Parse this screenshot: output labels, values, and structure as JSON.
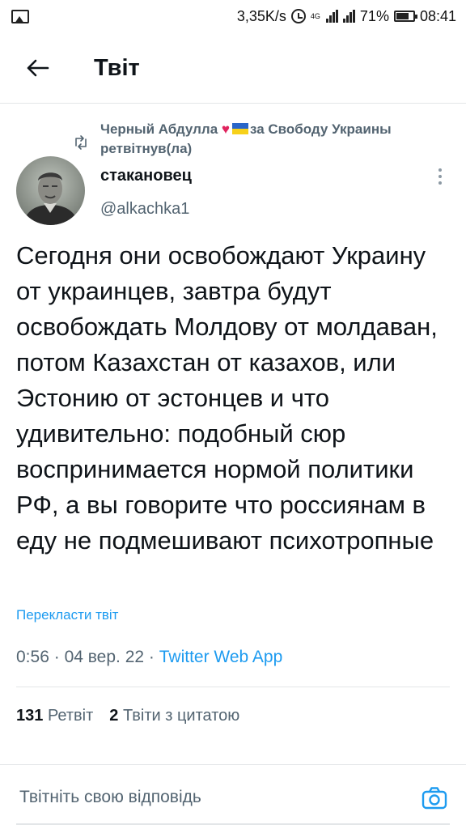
{
  "status_bar": {
    "speed": "3,35K/s",
    "network_tag": "4G",
    "battery": "71%",
    "time": "08:41",
    "icons": [
      "image-icon",
      "alarm-icon",
      "signal-icon",
      "battery-icon"
    ]
  },
  "header": {
    "title": "Твіт",
    "back_icon": "arrow-left-icon"
  },
  "retweet": {
    "user": "Черный Абдулла",
    "heart": "♥",
    "suffix": "за Свободу Украины",
    "label": "ретвітнув(ла)"
  },
  "author": {
    "name": "стакановец",
    "handle": "@alkachka1"
  },
  "tweet": {
    "text": "Сегодня они освобождают Украину от украинцев, завтра будут освобождать Молдову от молдаван, потом Казахстан от казахов, или Эстонию от эстонцев и что удивительно: подобный сюр воспринимается нормой политики РФ, а вы говорите что россиянам в еду не подмешивают психотропные",
    "translate_label": "Перекласти твіт",
    "time": "0:56",
    "date": "04 вер. 22",
    "separator": "·",
    "app": "Twitter Web App"
  },
  "stats": {
    "retweets_count": "131",
    "retweets_label": "Ретвіт",
    "quotes_count": "2",
    "quotes_label": "Твіти з цитатою"
  },
  "reply": {
    "placeholder": "Твітніть свою відповідь"
  },
  "colors": {
    "accent": "#1d9bf0",
    "secondary_text": "#536471",
    "heart": "#e0245e",
    "flag_blue": "#2a66c9",
    "flag_yellow": "#f7d11a"
  }
}
